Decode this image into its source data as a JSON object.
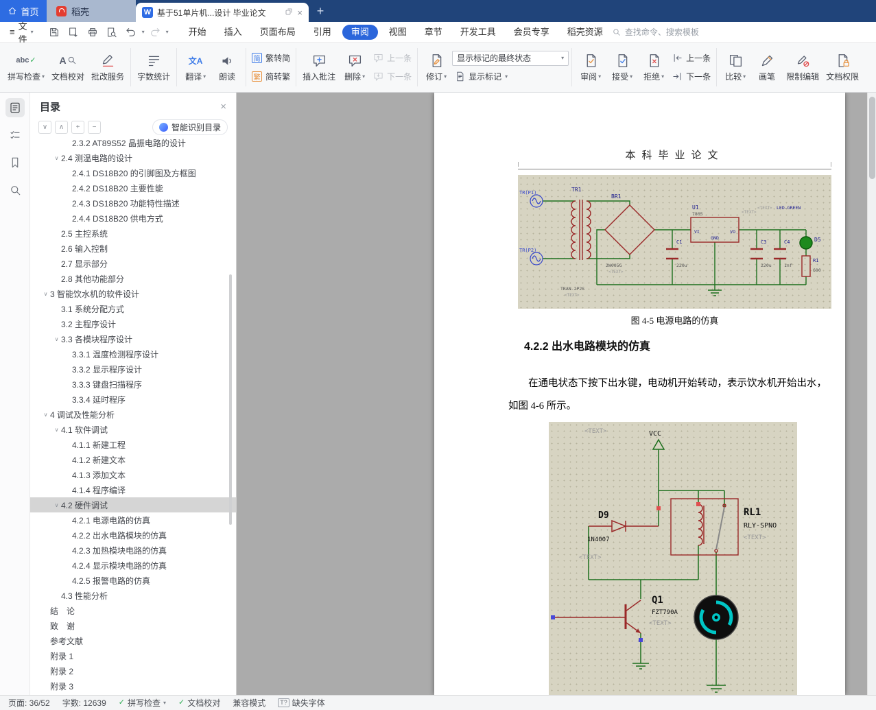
{
  "icons": {
    "hamburger": "≡",
    "caret": "▾",
    "close": "×",
    "plus": "+",
    "w_logo": "W",
    "check": "✓",
    "expand_all": "∨",
    "collapse_all": "∧",
    "plus_sq": "+",
    "minus_sq": "−",
    "expander": "∨",
    "translate": "文A",
    "simp": "简",
    "trad": "繁",
    "spell_abc": "abc",
    "proof_a": "A",
    "missing_font": "T?"
  },
  "titlebar": {
    "home": "首页",
    "docer": "稻壳",
    "doc_tab": "基于51单片机...设计 毕业论文"
  },
  "menubar": {
    "file": "文件",
    "tabs": [
      "开始",
      "插入",
      "页面布局",
      "引用",
      "审阅",
      "视图",
      "章节",
      "开发工具",
      "会员专享",
      "稻壳资源"
    ],
    "active_tab": "审阅",
    "search": "查找命令、搜索模板"
  },
  "ribbon": {
    "spell_check": "拼写检查",
    "doc_proof": "文档校对",
    "correct": "批改服务",
    "word_count": "字数统计",
    "translate": "翻译",
    "read": "朗读",
    "t2s": "繁转简",
    "s2t": "简转繁",
    "insert_comment": "插入批注",
    "del": "删除",
    "prev_comment": "上一条",
    "next_comment": "下一条",
    "track": "修订",
    "markup_state": "显示标记的最终状态",
    "show_markup": "显示标记",
    "review": "审阅",
    "accept": "接受",
    "reject": "拒绝",
    "prev_change": "上一条",
    "next_change": "下一条",
    "compare": "比较",
    "pen": "画笔",
    "restrict": "限制编辑",
    "perm": "文档权限"
  },
  "nav_panel": {
    "title": "目录",
    "smart": "智能识别目录",
    "items": [
      {
        "text": "2.3.2 AT89S52 晶振电路的设计",
        "level": 3
      },
      {
        "text": "2.4 测温电路的设计",
        "level": 2,
        "expander": true
      },
      {
        "text": "2.4.1 DS18B20 的引脚图及方框图",
        "level": 3
      },
      {
        "text": "2.4.2 DS18B20 主要性能",
        "level": 3
      },
      {
        "text": "2.4.3 DS18B20 功能特性描述",
        "level": 3
      },
      {
        "text": "2.4.4 DS18B20 供电方式",
        "level": 3
      },
      {
        "text": "2.5 主控系统",
        "level": 2
      },
      {
        "text": "2.6 输入控制",
        "level": 2
      },
      {
        "text": "2.7 显示部分",
        "level": 2
      },
      {
        "text": "2.8 其他功能部分",
        "level": 2
      },
      {
        "text": "3 智能饮水机的软件设计",
        "level": 1,
        "expander": true
      },
      {
        "text": "3.1 系统分配方式",
        "level": 2
      },
      {
        "text": "3.2 主程序设计",
        "level": 2
      },
      {
        "text": "3.3 各模块程序设计",
        "level": 2,
        "expander": true
      },
      {
        "text": "3.3.1 温度检测程序设计",
        "level": 3
      },
      {
        "text": "3.3.2 显示程序设计",
        "level": 3
      },
      {
        "text": "3.3.3 键盘扫描程序",
        "level": 3
      },
      {
        "text": "3.3.4 延时程序",
        "level": 3
      },
      {
        "text": "4 调试及性能分析",
        "level": 1,
        "expander": true
      },
      {
        "text": "4.1 软件调试",
        "level": 2,
        "expander": true
      },
      {
        "text": "4.1.1 新建工程",
        "level": 3
      },
      {
        "text": "4.1.2 新建文本",
        "level": 3
      },
      {
        "text": "4.1.3 添加文本",
        "level": 3
      },
      {
        "text": "4.1.4 程序编译",
        "level": 3
      },
      {
        "text": "4.2 硬件调试",
        "level": 2,
        "expander": true,
        "selected": true
      },
      {
        "text": "4.2.1 电源电路的仿真",
        "level": 3
      },
      {
        "text": "4.2.2 出水电路模块的仿真",
        "level": 3
      },
      {
        "text": "4.2.3 加热模块电路的仿真",
        "level": 3
      },
      {
        "text": "4.2.4 显示模块电路的仿真",
        "level": 3
      },
      {
        "text": "4.2.5 报警电路的仿真",
        "level": 3
      },
      {
        "text": "4.3 性能分析",
        "level": 2
      },
      {
        "text": "结　论",
        "level": 1
      },
      {
        "text": "致　谢",
        "level": 1
      },
      {
        "text": "参考文献",
        "level": 1
      },
      {
        "text": "附录 1",
        "level": 1
      },
      {
        "text": "附录 2",
        "level": 1
      },
      {
        "text": "附录 3",
        "level": 1
      }
    ]
  },
  "document": {
    "header_title": "本科毕业论文",
    "figure_caption": "图 4-5 电源电路的仿真",
    "section_heading": "4.2.2 出水电路模块的仿真",
    "para_line1": "在通电状态下按下出水键，电动机开始转动，表示饮水机开始出水，",
    "para_line2": "如图 4-6 所示。",
    "circuit1": {
      "labels": {
        "tr_p1": "TR(P1)",
        "tr_p2": "TR(P2)",
        "tr1": "TR1",
        "tran_model": "TRAN-2P2S",
        "br1": "BR1",
        "br_model": "2W005G",
        "c1": "C1",
        "c1_val": "220u",
        "u1": "U1",
        "u1_model": "7805",
        "pin_vi": "VI",
        "pin_vo": "VO",
        "pin_gnd": "GND",
        "c3": "C3",
        "c3_val": "220u",
        "c4": "C4",
        "c4_val": "1nf",
        "led_name": "LED-GREEN",
        "d5": "D5",
        "r1": "R1",
        "r1_val": "600",
        "text_tag": "<TEXT>"
      }
    },
    "circuit2": {
      "labels": {
        "vcc": "VCC",
        "d9": "D9",
        "d9_model": "1N4007",
        "rl1": "RL1",
        "rl1_model": "RLY-SPNO",
        "q1": "Q1",
        "q1_model": "FZT790A",
        "text_tag": "<TEXT>"
      }
    }
  },
  "statusbar": {
    "page": "页面: 36/52",
    "words": "字数: 12639",
    "spell": "拼写检查",
    "proof": "文档校对",
    "compat": "兼容模式",
    "missing_font": "缺失字体"
  }
}
